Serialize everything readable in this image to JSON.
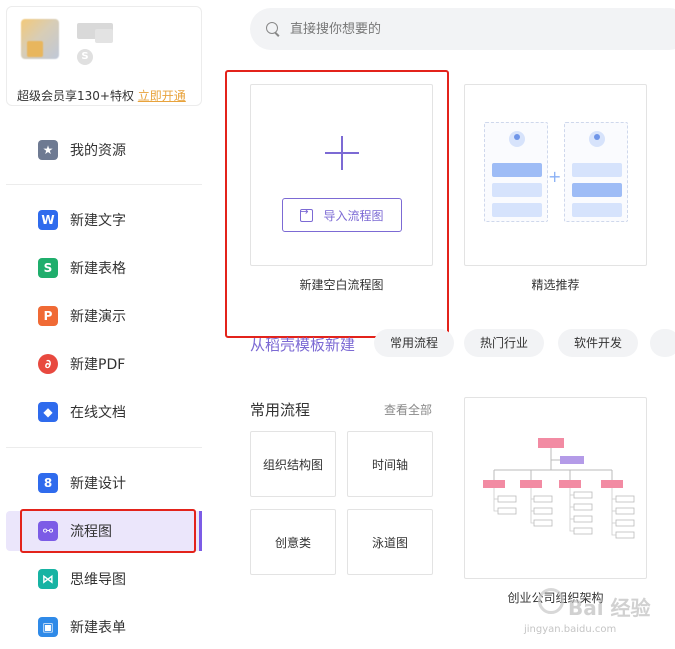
{
  "profile": {
    "member_text": "超级会员享130+特权",
    "member_link": "立即开通",
    "coin_icon": "vip-coin-icon"
  },
  "sidebar": {
    "items": [
      {
        "label": "我的资源",
        "icon": "star-icon",
        "color": "#6e7a92"
      },
      {
        "label": "新建文字",
        "icon": "word-doc-icon",
        "color": "#2f6bed"
      },
      {
        "label": "新建表格",
        "icon": "spreadsheet-icon",
        "color": "#1fae6c"
      },
      {
        "label": "新建演示",
        "icon": "presentation-icon",
        "color": "#f06a35"
      },
      {
        "label": "新建PDF",
        "icon": "pdf-icon",
        "color": "#e8493f"
      },
      {
        "label": "在线文档",
        "icon": "cloud-doc-icon",
        "color": "#2f6bed"
      },
      {
        "label": "新建设计",
        "icon": "design-icon",
        "color": "#2f6bed"
      },
      {
        "label": "流程图",
        "icon": "flowchart-icon",
        "color": "#7c5ce6"
      },
      {
        "label": "思维导图",
        "icon": "mindmap-icon",
        "color": "#17b3a3"
      },
      {
        "label": "新建表单",
        "icon": "form-icon",
        "color": "#2f8ae8"
      }
    ],
    "active_index": 7
  },
  "search": {
    "placeholder": "直接搜你想要的"
  },
  "cards": {
    "blank_title": "新建空白流程图",
    "import_label": "导入流程图",
    "featured_title": "精选推荐",
    "template_title": "创业公司组织架构"
  },
  "templates_section": {
    "link_text": "从稻壳模板新建",
    "tags": [
      "常用流程",
      "热门行业",
      "软件开发"
    ]
  },
  "common": {
    "title": "常用流程",
    "see_all": "查看全部",
    "tiles": [
      "组织结构图",
      "时间轴",
      "创意类",
      "泳道图"
    ]
  },
  "watermark": {
    "text": "Bai 经验",
    "url": "jingyan.baidu.com"
  },
  "colors": {
    "accent": "#7c6ad4",
    "highlight": "#e3231b",
    "active_bg": "#ebe6fb"
  }
}
